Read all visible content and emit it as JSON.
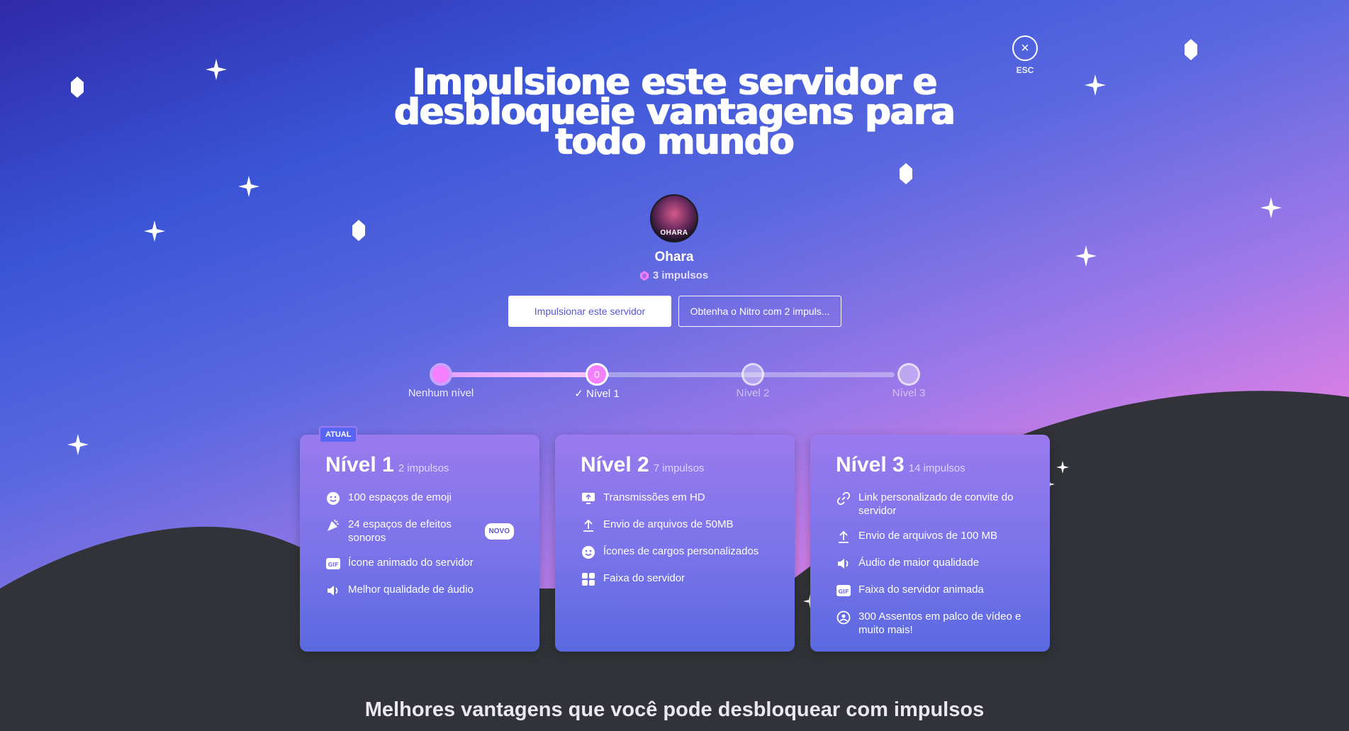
{
  "header": {
    "title": "Impulsione este servidor e desbloqueie vantagens para todo mundo",
    "close_hint": "ESC"
  },
  "server": {
    "name": "Ohara",
    "avatar_text": "OHARA",
    "boost_count": "3 impulsos"
  },
  "actions": {
    "boost_label": "Impulsionar este servidor",
    "nitro_label": "Obtenha o Nitro com 2 impuls..."
  },
  "progress": {
    "current_fraction": 0.37,
    "levels": [
      {
        "label": "Nenhum nível",
        "node_text": ""
      },
      {
        "label": "Nível 1",
        "node_text": "0"
      },
      {
        "label": "Nível 2",
        "node_text": ""
      },
      {
        "label": "Nível 3",
        "node_text": ""
      }
    ]
  },
  "tiers": [
    {
      "name": "Nível 1",
      "requirement": "2 impulsos",
      "badge": "ATUAL",
      "perks": [
        {
          "icon": "emoji-icon",
          "text": "100 espaços de emoji"
        },
        {
          "icon": "soundboard-icon",
          "text": "24 espaços de efeitos sonoros",
          "badge": "NOVO"
        },
        {
          "icon": "gif-icon",
          "text": "Ícone animado do servidor"
        },
        {
          "icon": "speaker-icon",
          "text": "Melhor qualidade de áudio"
        }
      ]
    },
    {
      "name": "Nível 2",
      "requirement": "7 impulsos",
      "perks": [
        {
          "icon": "screen-share-icon",
          "text": "Transmissões em HD"
        },
        {
          "icon": "upload-icon",
          "text": "Envio de arquivos de 50MB"
        },
        {
          "icon": "emoji-icon",
          "text": "Ícones de cargos personalizados"
        },
        {
          "icon": "grid-icon",
          "text": "Faixa do servidor"
        }
      ]
    },
    {
      "name": "Nível 3",
      "requirement": "14 impulsos",
      "perks": [
        {
          "icon": "link-icon",
          "text": "Link personalizado de convite do servidor"
        },
        {
          "icon": "upload-icon",
          "text": "Envio de arquivos de 100 MB"
        },
        {
          "icon": "speaker-icon",
          "text": "Áudio de maior qualidade"
        },
        {
          "icon": "gif-icon",
          "text": "Faixa do servidor animada"
        },
        {
          "icon": "stage-icon",
          "text": "300 Assentos em palco de vídeo e muito mais!"
        }
      ]
    }
  ],
  "footer": {
    "section_title": "Melhores vantagens que você pode desbloquear com impulsos"
  },
  "colors": {
    "accent": "#5865f2",
    "boost_pink": "#f47fff",
    "hill": "#313338"
  }
}
